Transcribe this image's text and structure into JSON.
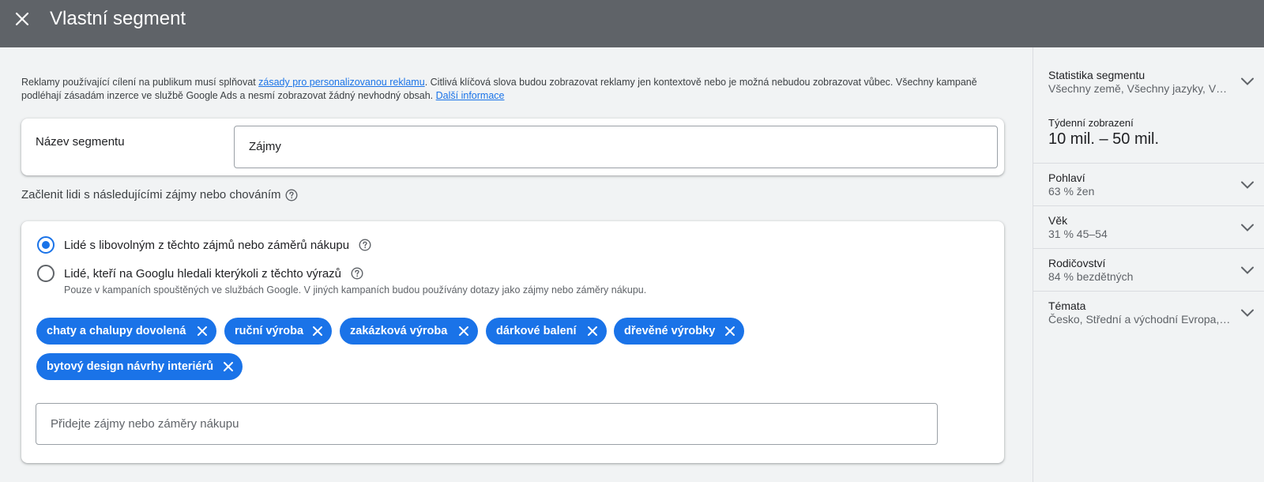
{
  "header": {
    "title": "Vlastní segment"
  },
  "notice": {
    "text_before": "Reklamy používající cílení na publikum musí splňovat ",
    "policy_link": "zásady pro personalizovanou reklamu",
    "text_after": ". Citlivá klíčová slova budou zobrazovat reklamy jen kontextově nebo je možná nebudou zobrazovat vůbec. Všechny kampaně podléhají zásadám inzerce ve službě Google Ads a nesmí zobrazovat žádný nevhodný obsah. ",
    "more_link": "Další informace"
  },
  "segment_name": {
    "label": "Název segmentu",
    "value": "Zájmy"
  },
  "include_section": {
    "label": "Začlenit lidi s následujícími zájmy nebo chováním"
  },
  "targeting": {
    "option1": "Lidé s libovolným z těchto zájmů nebo záměrů nákupu",
    "option2": "Lidé, kteří na Googlu hledali kterýkoli z těchto výrazů",
    "option2_sub": "Pouze v kampaních spouštěných ve službách Google. V jiných kampaních budou používány dotazy jako zájmy nebo záměry nákupu.",
    "selected": "option1",
    "chips": [
      "chaty a chalupy dovolená",
      "ruční výroba",
      "zakázková výroba",
      "dárkové balení",
      "dřevěné výrobky",
      "bytový design návrhy interiérů"
    ],
    "add_placeholder": "Přidejte zájmy nebo záměry nákupu"
  },
  "sidebar": {
    "stats_title": "Statistika segmentu",
    "stats_value": "Všechny země, Všechny jazyky, Vš…",
    "weekly_label": "Týdenní zobrazení",
    "weekly_value": "10 mil. – 50 mil.",
    "items": [
      {
        "title": "Pohlaví",
        "value": "63 % žen"
      },
      {
        "title": "Věk",
        "value": "31 % 45–54"
      },
      {
        "title": "Rodičovství",
        "value": "84 % bezdětných"
      },
      {
        "title": "Témata",
        "value": "Česko, Střední a východní Evropa, …"
      }
    ]
  },
  "colors": {
    "header_bg": "#5f6368",
    "accent": "#1a73e8",
    "page_bg": "#f1f3f4"
  }
}
